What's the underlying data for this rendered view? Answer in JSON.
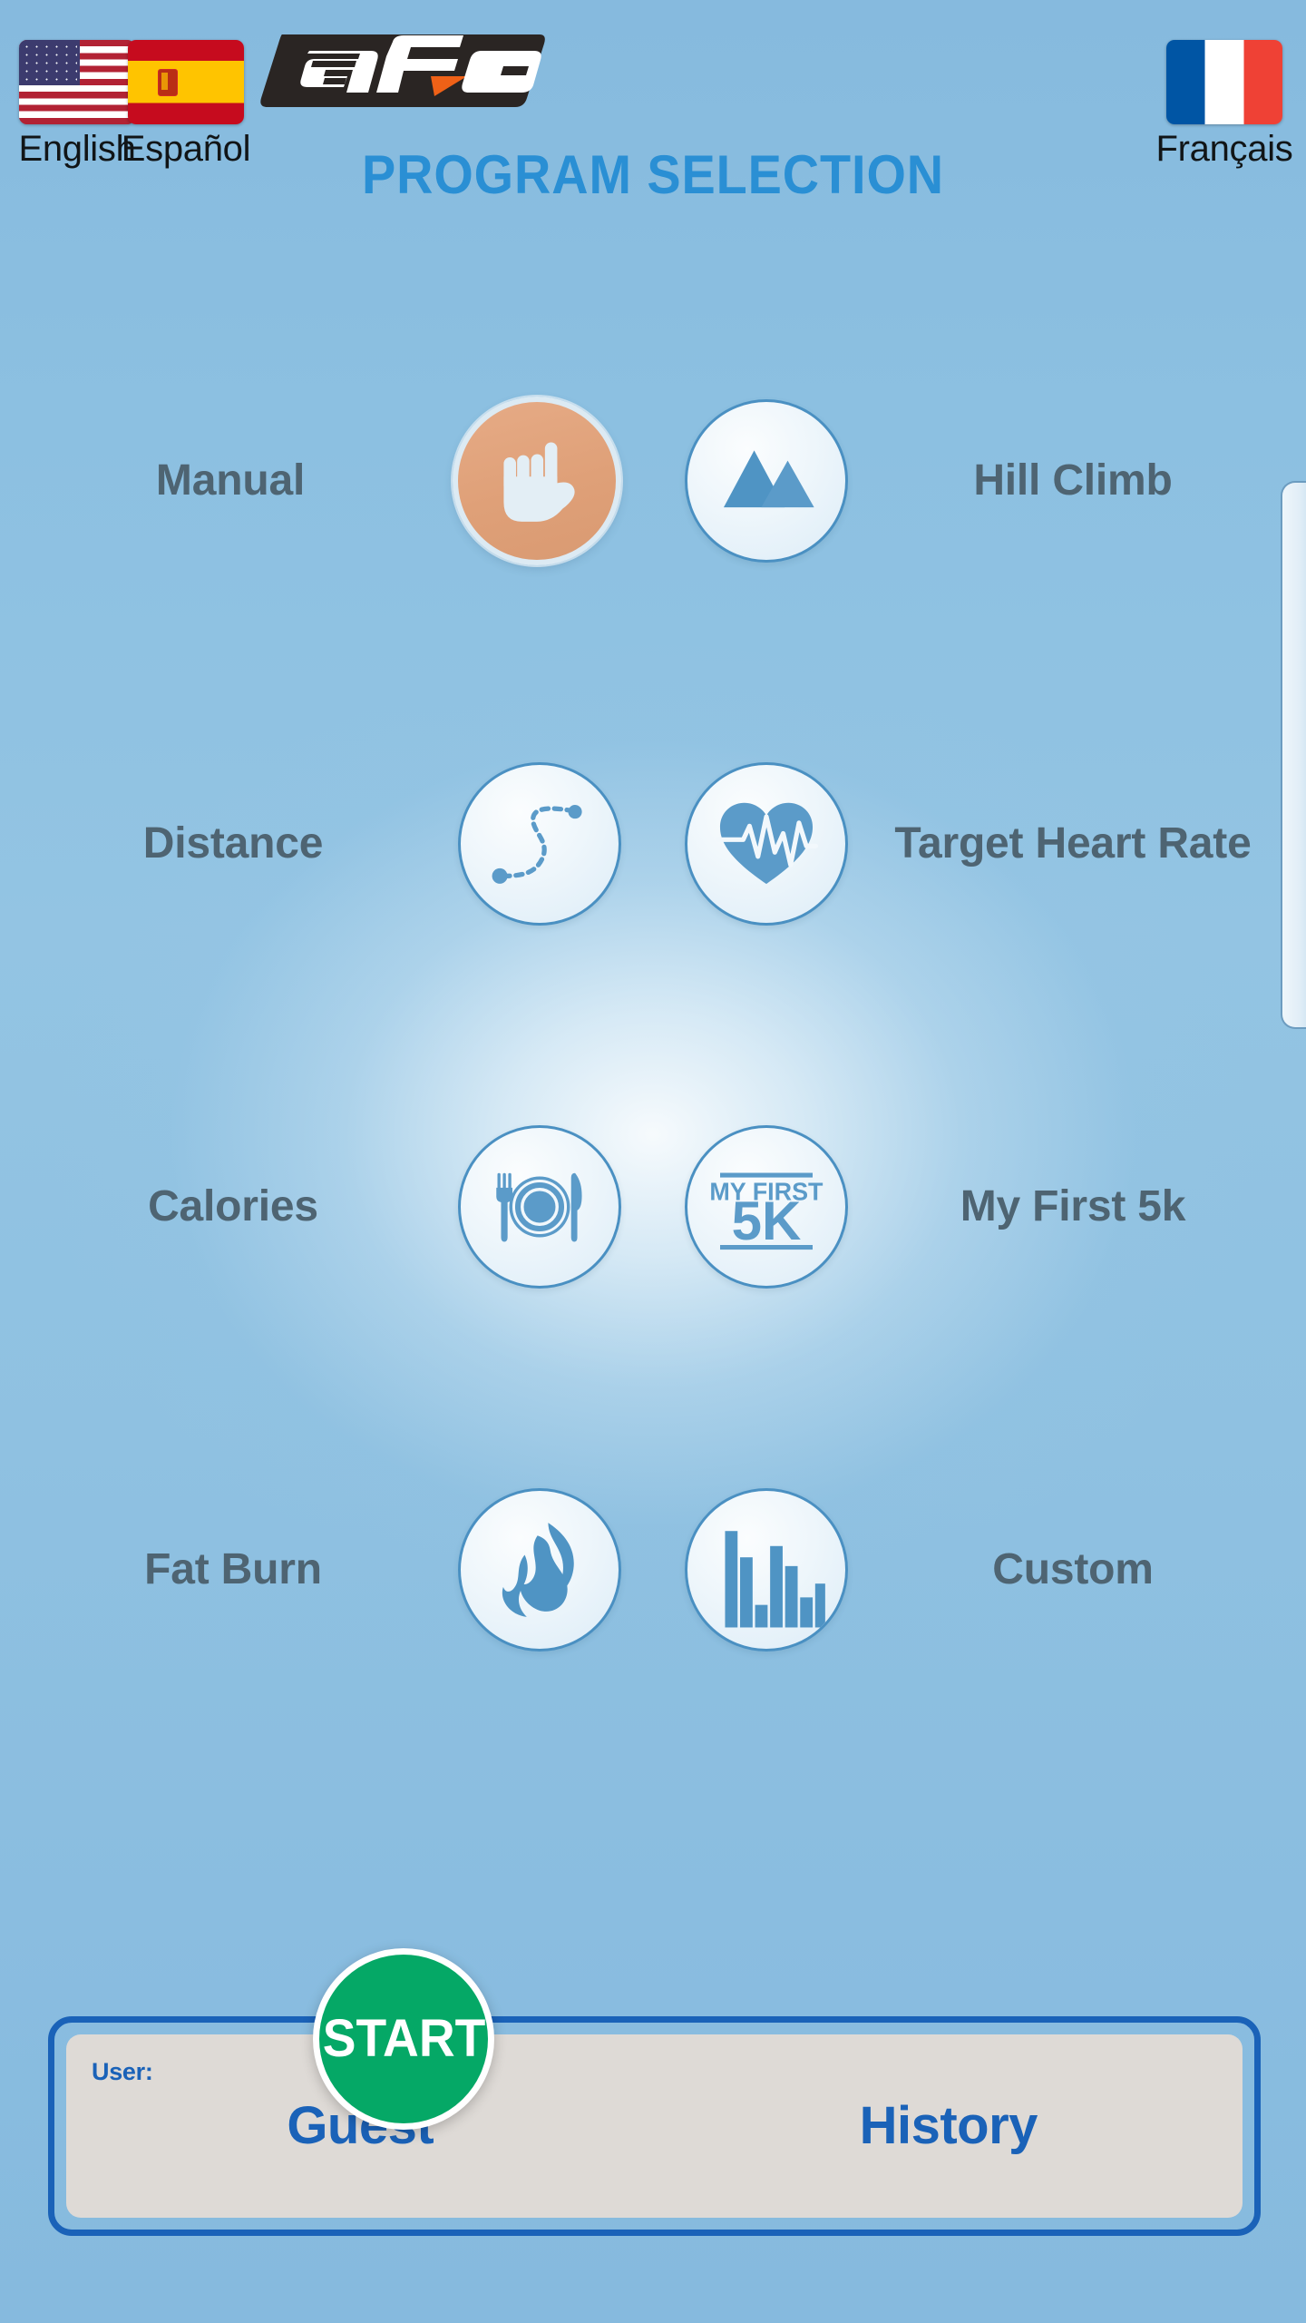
{
  "header": {
    "languages": [
      {
        "label": "English",
        "flag": "us-flag-icon"
      },
      {
        "label": "Español",
        "flag": "es-flag-icon"
      },
      {
        "label": "Français",
        "flag": "fr-flag-icon"
      }
    ],
    "brand_logo": "afg-logo",
    "brand_name": "AFG"
  },
  "title": "PROGRAM SELECTION",
  "programs": [
    {
      "label": "Manual",
      "icon": "hand-icon",
      "selected": true
    },
    {
      "label": "Hill Climb",
      "icon": "mountains-icon",
      "selected": false
    },
    {
      "label": "Distance",
      "icon": "dashed-path-icon",
      "selected": false
    },
    {
      "label": "Target Heart Rate",
      "icon": "heart-ecg-icon",
      "selected": false
    },
    {
      "label": "Calories",
      "icon": "plate-icon",
      "selected": false
    },
    {
      "label": "My First 5k",
      "icon": "my-first-5k-icon",
      "selected": false
    },
    {
      "label": "Fat Burn",
      "icon": "flame-icon",
      "selected": false
    },
    {
      "label": "Custom",
      "icon": "bar-chart-icon",
      "selected": false
    }
  ],
  "icon_text": {
    "five_k_top": "MY FIRST",
    "five_k_main": "5K"
  },
  "footer": {
    "user_label": "User:",
    "user_name": "Guest",
    "history_label": "History",
    "start_label": "START"
  },
  "colors": {
    "title_blue": "#2a8fd4",
    "label_gray": "#4e6472",
    "icon_blue": "#5b9bc9",
    "border_blue": "#4a90c2",
    "accent_blue": "#1a62b8",
    "start_green": "#05a866",
    "selected_tan": "#dfa078",
    "background_blue": "#8cc0e1",
    "panel_gray": "#dedad6",
    "logo_orange": "#ef6117"
  },
  "scrollbar": {
    "name": "vertical-scrollbar"
  }
}
